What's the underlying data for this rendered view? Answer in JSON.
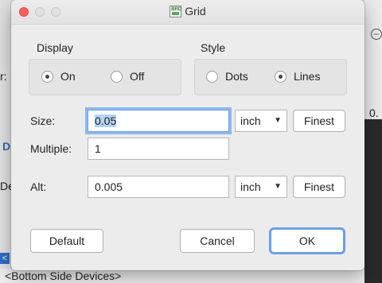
{
  "window": {
    "title": "Grid",
    "app_icon": "BRD"
  },
  "display": {
    "label": "Display",
    "options": [
      {
        "label": "On",
        "selected": true
      },
      {
        "label": "Off",
        "selected": false
      }
    ]
  },
  "style": {
    "label": "Style",
    "options": [
      {
        "label": "Dots",
        "selected": false
      },
      {
        "label": "Lines",
        "selected": true
      }
    ]
  },
  "size": {
    "label": "Size:",
    "value": "0.05",
    "unit": "inch",
    "finest": "Finest"
  },
  "multiple": {
    "label": "Multiple:",
    "value": "1"
  },
  "alt": {
    "label": "Alt:",
    "value": "0.005",
    "unit": "inch",
    "finest": "Finest"
  },
  "buttons": {
    "default": "Default",
    "cancel": "Cancel",
    "ok": "OK"
  },
  "background": {
    "left_fragments": [
      "r:",
      "D",
      "De"
    ],
    "right_fragment": "0.",
    "bottom_text": "<Bottom Side Devices>",
    "blue_tag": "<"
  }
}
